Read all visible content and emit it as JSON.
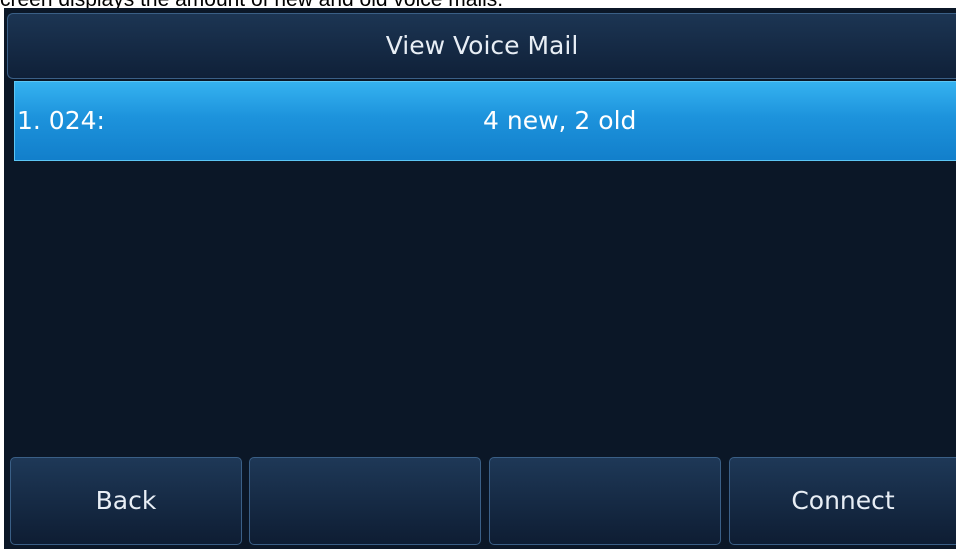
{
  "caption": "creen displays the amount of new and old voice mails.",
  "screen": {
    "title": "View Voice Mail",
    "items": [
      {
        "index": "1. 024:",
        "status": "4 new, 2 old"
      }
    ],
    "softkeys": [
      "Back",
      "",
      "",
      "Connect"
    ]
  },
  "colors": {
    "background": "#0b1727",
    "highlight": "#1d93dc",
    "text": "#e8eef5"
  }
}
